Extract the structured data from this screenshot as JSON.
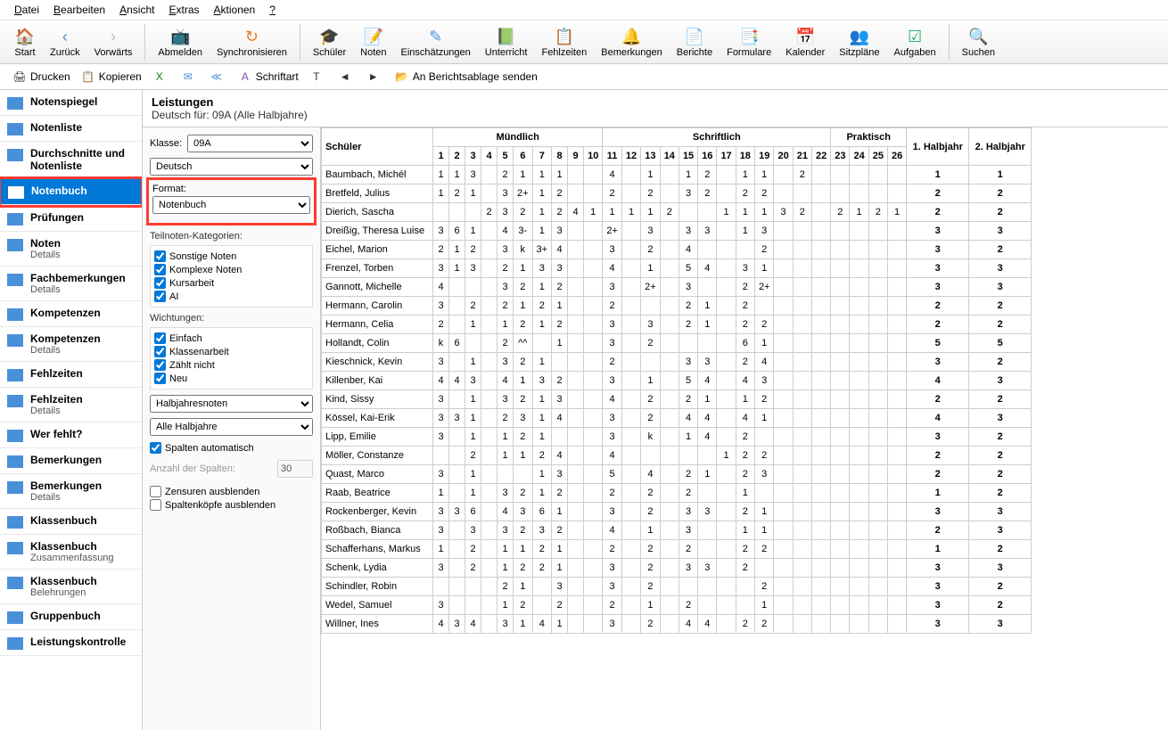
{
  "menu": [
    "Datei",
    "Bearbeiten",
    "Ansicht",
    "Extras",
    "Aktionen",
    "?"
  ],
  "toolbar": [
    {
      "label": "Start",
      "icon": "🏠",
      "color": "#d11"
    },
    {
      "label": "Zurück",
      "icon": "‹",
      "color": "#4a90d9"
    },
    {
      "label": "Vorwärts",
      "icon": "›",
      "color": "#bbb"
    },
    {
      "sep": true
    },
    {
      "label": "Abmelden",
      "icon": "📺",
      "color": "#e74c3c"
    },
    {
      "label": "Synchronisieren",
      "icon": "↻",
      "color": "#e67e22"
    },
    {
      "sep": true
    },
    {
      "label": "Schüler",
      "icon": "🎓",
      "color": "#333"
    },
    {
      "label": "Noten",
      "icon": "📝",
      "color": "#e67e22"
    },
    {
      "label": "Einschätzungen",
      "icon": "✎",
      "color": "#4a90d9"
    },
    {
      "label": "Unterricht",
      "icon": "📗",
      "color": "#27ae60"
    },
    {
      "label": "Fehlzeiten",
      "icon": "📋",
      "color": "#e74c3c"
    },
    {
      "label": "Bemerkungen",
      "icon": "🔔",
      "color": "#f1c40f"
    },
    {
      "label": "Berichte",
      "icon": "📄",
      "color": "#4a90d9"
    },
    {
      "label": "Formulare",
      "icon": "📑",
      "color": "#4a90d9"
    },
    {
      "label": "Kalender",
      "icon": "📅",
      "color": "#e74c3c"
    },
    {
      "label": "Sitzpläne",
      "icon": "👥",
      "color": "#e67e22"
    },
    {
      "label": "Aufgaben",
      "icon": "☑",
      "color": "#27ae60"
    },
    {
      "sep": true
    },
    {
      "label": "Suchen",
      "icon": "🔍",
      "color": "#4a90d9"
    }
  ],
  "sec_toolbar": [
    {
      "label": "Drucken",
      "icon": "🖨"
    },
    {
      "label": "Kopieren",
      "icon": "📋"
    },
    {
      "label": "",
      "icon": "X",
      "color": "#107c10"
    },
    {
      "label": "",
      "icon": "✉",
      "color": "#4a90d9"
    },
    {
      "label": "",
      "icon": "≪",
      "color": "#4a90d9"
    },
    {
      "label": "Schriftart",
      "icon": "A",
      "color": "#8e44ad"
    },
    {
      "label": "",
      "icon": "T",
      "color": "#333"
    },
    {
      "label": "",
      "icon": "◄",
      "color": "#333"
    },
    {
      "label": "",
      "icon": "►",
      "color": "#333"
    },
    {
      "label": "An Berichtsablage senden",
      "icon": "📂",
      "color": "#e67e22"
    }
  ],
  "sidebar": [
    {
      "label": "Notenspiegel"
    },
    {
      "label": "Notenliste"
    },
    {
      "label": "Durchschnitte und Notenliste"
    },
    {
      "label": "Notenbuch",
      "active": true,
      "boxed": true
    },
    {
      "label": "Prüfungen"
    },
    {
      "label": "Noten",
      "sub": "Details"
    },
    {
      "label": "Fachbemerkungen",
      "sub": "Details"
    },
    {
      "label": "Kompetenzen"
    },
    {
      "label": "Kompetenzen",
      "sub": "Details"
    },
    {
      "label": "Fehlzeiten"
    },
    {
      "label": "Fehlzeiten",
      "sub": "Details"
    },
    {
      "label": "Wer fehlt?"
    },
    {
      "label": "Bemerkungen"
    },
    {
      "label": "Bemerkungen",
      "sub": "Details"
    },
    {
      "label": "Klassenbuch"
    },
    {
      "label": "Klassenbuch",
      "sub": "Zusammenfassung"
    },
    {
      "label": "Klassenbuch",
      "sub": "Belehrungen"
    },
    {
      "label": "Gruppenbuch"
    },
    {
      "label": "Leistungskontrolle"
    }
  ],
  "header": {
    "title": "Leistungen",
    "subtitle": "Deutsch für: 09A (Alle Halbjahre)"
  },
  "filter": {
    "klasse_label": "Klasse:",
    "klasse_value": "09A",
    "fach_value": "Deutsch",
    "format_label": "Format:",
    "format_value": "Notenbuch",
    "teilnoten_label": "Teilnoten-Kategorien:",
    "teilnoten": [
      "Sonstige Noten",
      "Komplexe Noten",
      "Kursarbeit",
      "AI"
    ],
    "wichtungen_label": "Wichtungen:",
    "wichtungen": [
      "Einfach",
      "Klassenarbeit",
      "Zählt nicht",
      "Neu"
    ],
    "halbjahresnoten": "Halbjahresnoten",
    "alle_halbjahre": "Alle Halbjahre",
    "spalten_auto": "Spalten automatisch",
    "anzahl_label": "Anzahl der Spalten:",
    "anzahl_value": "30",
    "zensuren": "Zensuren ausblenden",
    "spaltenkoepfe": "Spaltenköpfe ausblenden"
  },
  "table": {
    "student_header": "Schüler",
    "groups": [
      {
        "label": "Mündlich",
        "cols": [
          "1",
          "2",
          "3",
          "4",
          "5",
          "6",
          "7",
          "8",
          "9",
          "10"
        ]
      },
      {
        "label": "Schriftlich",
        "cols": [
          "11",
          "12",
          "13",
          "14",
          "15",
          "16",
          "17",
          "18",
          "19",
          "20",
          "21",
          "22"
        ]
      },
      {
        "label": "Praktisch",
        "cols": [
          "23",
          "24",
          "25",
          "26"
        ]
      }
    ],
    "hj": [
      "1. Halbjahr",
      "2. Halbjahr"
    ],
    "rows": [
      {
        "name": "Baumbach, Michél",
        "m": [
          "1",
          "1",
          "3",
          "",
          "2",
          "1",
          "1",
          "1",
          "",
          " "
        ],
        "s": [
          "4",
          "",
          "1",
          "",
          "1",
          "2",
          "",
          "1",
          "1",
          "",
          "2",
          ""
        ],
        "p": [
          "",
          "",
          "",
          ""
        ],
        "h": [
          "1",
          "1"
        ]
      },
      {
        "name": "Bretfeld, Julius",
        "m": [
          "1",
          "2",
          "1",
          "",
          "3",
          "2+",
          "1",
          "2",
          "",
          ""
        ],
        "s": [
          "2",
          "",
          "2",
          "",
          "3",
          "2",
          "",
          "2",
          "2",
          "",
          "",
          ""
        ],
        "p": [
          "",
          "",
          "",
          ""
        ],
        "h": [
          "2",
          "2"
        ]
      },
      {
        "name": "Dierich, Sascha",
        "m": [
          "",
          "",
          "",
          "2",
          "3",
          "2",
          "1",
          "2",
          "4",
          "1"
        ],
        "s": [
          "1",
          "1",
          "1",
          "2",
          "",
          "",
          "1",
          "1",
          "1",
          "3",
          "2",
          ""
        ],
        "p": [
          "2",
          "1",
          "2",
          "1"
        ],
        "h": [
          "2",
          "2"
        ]
      },
      {
        "name": "Dreißig, Theresa Luise",
        "m": [
          "3",
          "6",
          "1",
          "",
          "4",
          "3-",
          "1",
          "3",
          "",
          ""
        ],
        "s": [
          "2+",
          "",
          "3",
          "",
          "3",
          "3",
          "",
          "1",
          "3",
          "",
          "",
          ""
        ],
        "p": [
          "",
          "",
          "",
          ""
        ],
        "h": [
          "3",
          "3"
        ]
      },
      {
        "name": "Eichel, Marion",
        "m": [
          "2",
          "1",
          "2",
          "",
          "3",
          "k",
          "3+",
          "4",
          "",
          ""
        ],
        "s": [
          "3",
          "",
          "2",
          "",
          "4",
          "",
          "",
          "",
          "2",
          "",
          "",
          ""
        ],
        "p": [
          "",
          "",
          "",
          ""
        ],
        "h": [
          "3",
          "2"
        ]
      },
      {
        "name": "Frenzel, Torben",
        "m": [
          "3",
          "1",
          "3",
          "",
          "2",
          "1",
          "3",
          "3",
          "",
          ""
        ],
        "s": [
          "4",
          "",
          "1",
          "",
          "5",
          "4",
          "",
          "3",
          "1",
          "",
          "",
          ""
        ],
        "p": [
          "",
          "",
          "",
          ""
        ],
        "h": [
          "3",
          "3"
        ]
      },
      {
        "name": "Gannott, Michelle",
        "m": [
          "4",
          "",
          "",
          "",
          "3",
          "2",
          "1",
          "2",
          "",
          ""
        ],
        "s": [
          "3",
          "",
          "2+",
          "",
          "3",
          "",
          "",
          "2",
          "2+",
          "",
          "",
          ""
        ],
        "p": [
          "",
          "",
          "",
          ""
        ],
        "h": [
          "3",
          "3"
        ]
      },
      {
        "name": "Hermann, Carolin",
        "m": [
          "3",
          "",
          "2",
          "",
          "2",
          "1",
          "2",
          "1",
          "",
          ""
        ],
        "s": [
          "2",
          "",
          "",
          "",
          "2",
          "1",
          "",
          "2",
          "",
          "",
          "",
          ""
        ],
        "p": [
          "",
          "",
          "",
          ""
        ],
        "h": [
          "2",
          "2"
        ]
      },
      {
        "name": "Hermann, Celia",
        "m": [
          "2",
          "",
          "1",
          "",
          "1",
          "2",
          "1",
          "2",
          "",
          ""
        ],
        "s": [
          "3",
          "",
          "3",
          "",
          "2",
          "1",
          "",
          "2",
          "2",
          "",
          "",
          ""
        ],
        "p": [
          "",
          "",
          "",
          ""
        ],
        "h": [
          "2",
          "2"
        ]
      },
      {
        "name": "Hollandt, Colin",
        "m": [
          "k",
          "6",
          "",
          "",
          "2",
          "^^",
          "",
          "1",
          "",
          ""
        ],
        "s": [
          "3",
          "",
          "2",
          "",
          "",
          "",
          "",
          "6",
          "1",
          "",
          "",
          ""
        ],
        "p": [
          "",
          "",
          "",
          ""
        ],
        "h": [
          "5",
          "5"
        ]
      },
      {
        "name": "Kieschnick, Kevin",
        "m": [
          "3",
          "",
          "1",
          "",
          "3",
          "2",
          "1",
          "",
          "",
          ""
        ],
        "s": [
          "2",
          "",
          "",
          "",
          "3",
          "3",
          "",
          "2",
          "4",
          "",
          "",
          ""
        ],
        "p": [
          "",
          "",
          "",
          ""
        ],
        "h": [
          "3",
          "2"
        ]
      },
      {
        "name": "Killenber, Kai",
        "m": [
          "4",
          "4",
          "3",
          "",
          "4",
          "1",
          "3",
          "2",
          "",
          ""
        ],
        "s": [
          "3",
          "",
          "1",
          "",
          "5",
          "4",
          "",
          "4",
          "3",
          "",
          "",
          ""
        ],
        "p": [
          "",
          "",
          "",
          ""
        ],
        "h": [
          "4",
          "3"
        ]
      },
      {
        "name": "Kind, Sissy",
        "m": [
          "3",
          "",
          "1",
          "",
          "3",
          "2",
          "1",
          "3",
          "",
          ""
        ],
        "s": [
          "4",
          "",
          "2",
          "",
          "2",
          "1",
          "",
          "1",
          "2",
          "",
          "",
          ""
        ],
        "p": [
          "",
          "",
          "",
          ""
        ],
        "h": [
          "2",
          "2"
        ]
      },
      {
        "name": "Kössel, Kai-Erik",
        "m": [
          "3",
          "3",
          "1",
          "",
          "2",
          "3",
          "1",
          "4",
          "",
          ""
        ],
        "s": [
          "3",
          "",
          "2",
          "",
          "4",
          "4",
          "",
          "4",
          "1",
          "",
          "",
          ""
        ],
        "p": [
          "",
          "",
          "",
          ""
        ],
        "h": [
          "4",
          "3"
        ]
      },
      {
        "name": "Lipp, Emilie",
        "m": [
          "3",
          "",
          "1",
          "",
          "1",
          "2",
          "1",
          "",
          "",
          ""
        ],
        "s": [
          "3",
          "",
          "k",
          "",
          "1",
          "4",
          "",
          "2",
          "",
          "",
          "",
          ""
        ],
        "p": [
          "",
          "",
          "",
          ""
        ],
        "h": [
          "3",
          "2"
        ]
      },
      {
        "name": "Möller, Constanze",
        "m": [
          "",
          "",
          "2",
          "",
          "1",
          "1",
          "2",
          "4",
          "",
          ""
        ],
        "s": [
          "4",
          "",
          "",
          "",
          "",
          "",
          "1",
          "2",
          "2",
          "",
          "",
          ""
        ],
        "p": [
          "",
          "",
          "",
          ""
        ],
        "h": [
          "2",
          "2"
        ]
      },
      {
        "name": "Quast, Marco",
        "m": [
          "3",
          "",
          "1",
          "",
          "",
          "",
          "1",
          "3",
          "",
          ""
        ],
        "s": [
          "5",
          "",
          "4",
          "",
          "2",
          "1",
          "",
          "2",
          "3",
          "",
          "",
          ""
        ],
        "p": [
          "",
          "",
          "",
          ""
        ],
        "h": [
          "2",
          "2"
        ]
      },
      {
        "name": "Raab, Beatrice",
        "m": [
          "1",
          "",
          "1",
          "",
          "3",
          "2",
          "1",
          "2",
          "",
          ""
        ],
        "s": [
          "2",
          "",
          "2",
          "",
          "2",
          "",
          "",
          "1",
          "",
          "",
          "",
          ""
        ],
        "p": [
          "",
          "",
          "",
          ""
        ],
        "h": [
          "1",
          "2"
        ]
      },
      {
        "name": "Rockenberger, Kevin",
        "m": [
          "3",
          "3",
          "6",
          "",
          "4",
          "3",
          "6",
          "1",
          "",
          ""
        ],
        "s": [
          "3",
          "",
          "2",
          "",
          "3",
          "3",
          "",
          "2",
          "1",
          "",
          "",
          ""
        ],
        "p": [
          "",
          "",
          "",
          ""
        ],
        "h": [
          "3",
          "3"
        ]
      },
      {
        "name": "Roßbach, Bianca",
        "m": [
          "3",
          "",
          "3",
          "",
          "3",
          "2",
          "3",
          "2",
          "",
          ""
        ],
        "s": [
          "4",
          "",
          "1",
          "",
          "3",
          "",
          "",
          "1",
          "1",
          "",
          "",
          ""
        ],
        "p": [
          "",
          "",
          "",
          ""
        ],
        "h": [
          "2",
          "3"
        ]
      },
      {
        "name": "Schafferhans, Markus",
        "m": [
          "1",
          "",
          "2",
          "",
          "1",
          "1",
          "2",
          "1",
          "",
          ""
        ],
        "s": [
          "2",
          "",
          "2",
          "",
          "2",
          "",
          "",
          "2",
          "2",
          "",
          "",
          ""
        ],
        "p": [
          "",
          "",
          "",
          ""
        ],
        "h": [
          "1",
          "2"
        ]
      },
      {
        "name": "Schenk, Lydia",
        "m": [
          "3",
          "",
          "2",
          "",
          "1",
          "2",
          "2",
          "1",
          "",
          ""
        ],
        "s": [
          "3",
          "",
          "2",
          "",
          "3",
          "3",
          "",
          "2",
          "",
          "",
          "",
          ""
        ],
        "p": [
          "",
          "",
          "",
          ""
        ],
        "h": [
          "3",
          "3"
        ]
      },
      {
        "name": "Schindler, Robin",
        "m": [
          "",
          "",
          "",
          "",
          "2",
          "1",
          "",
          "3",
          "",
          ""
        ],
        "s": [
          "3",
          "",
          "2",
          "",
          "",
          "",
          "",
          "",
          "2",
          "",
          "",
          ""
        ],
        "p": [
          "",
          "",
          "",
          ""
        ],
        "h": [
          "3",
          "2"
        ]
      },
      {
        "name": "Wedel, Samuel",
        "m": [
          "3",
          "",
          "",
          "",
          "1",
          "2",
          "",
          "2",
          "",
          ""
        ],
        "s": [
          "2",
          "",
          "1",
          "",
          "2",
          "",
          "",
          "",
          "1",
          "",
          "",
          ""
        ],
        "p": [
          "",
          "",
          "",
          ""
        ],
        "h": [
          "3",
          "2"
        ]
      },
      {
        "name": "Willner, Ines",
        "m": [
          "4",
          "3",
          "4",
          "",
          "3",
          "1",
          "4",
          "1",
          "",
          ""
        ],
        "s": [
          "3",
          "",
          "2",
          "",
          "4",
          "4",
          "",
          "2",
          "2",
          "",
          "",
          ""
        ],
        "p": [
          "",
          "",
          "",
          ""
        ],
        "h": [
          "3",
          "3"
        ]
      }
    ]
  }
}
